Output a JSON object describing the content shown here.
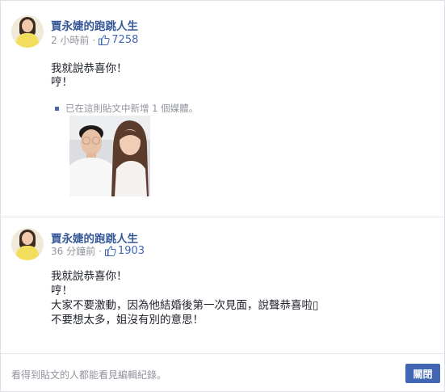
{
  "posts": [
    {
      "author": "賈永婕的跑跳人生",
      "time": "2 小時前",
      "separator": "·",
      "like_count": "7258",
      "lines": [
        "我就說恭喜你！",
        "哼！"
      ],
      "media_note": "已在這則貼文中新增 1 個媒體。",
      "photo_icon": "selfie-photo"
    },
    {
      "author": "賈永婕的跑跳人生",
      "time": "36 分鐘前",
      "separator": "·",
      "like_count": "1903",
      "lines": [
        "我就說恭喜你！",
        "哼！",
        "大家不要激動，因為他結婚後第一次見面，說聲恭喜啦▯",
        "不要想太多，姐沒有別的意思！"
      ]
    }
  ],
  "footer": {
    "note": "看得到貼文的人都能看見編輯紀錄。",
    "close_label": "關閉"
  },
  "colors": {
    "link": "#365899",
    "meta": "#90949c",
    "button": "#4267b2"
  }
}
